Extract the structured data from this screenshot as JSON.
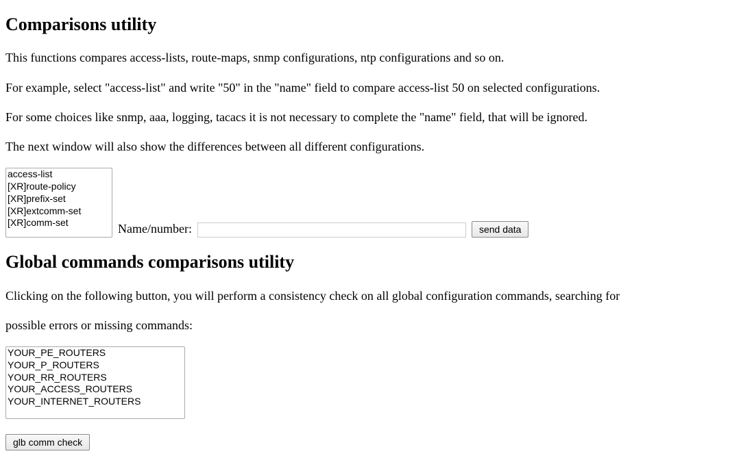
{
  "section1": {
    "title": "Comparisons utility",
    "p1": "This functions compares access-lists, route-maps, snmp configurations, ntp configurations and so on.",
    "p2": "For example, select \"access-list\" and write \"50\" in the \"name\" field to compare access-list 50 on selected configurations.",
    "p3": "For some choices like snmp, aaa, logging, tacacs it is not necessary to complete the \"name\" field, that will be ignored.",
    "p4": "The next window will also show the differences between all different configurations.",
    "config_options": [
      "access-list",
      "[XR]route-policy",
      "[XR]prefix-set",
      "[XR]extcomm-set",
      "[XR]comm-set"
    ],
    "name_label": "Name/number:",
    "name_value": "",
    "send_button": "send data"
  },
  "section2": {
    "title": "Global commands comparisons utility",
    "p1": "Clicking on the following button, you will perform a consistency check on all global configuration commands, searching for",
    "p2": "possible errors or missing commands:",
    "router_options": [
      "YOUR_PE_ROUTERS",
      "YOUR_P_ROUTERS",
      "YOUR_RR_ROUTERS",
      "YOUR_ACCESS_ROUTERS",
      "YOUR_INTERNET_ROUTERS"
    ],
    "glb_button": "glb comm check"
  }
}
